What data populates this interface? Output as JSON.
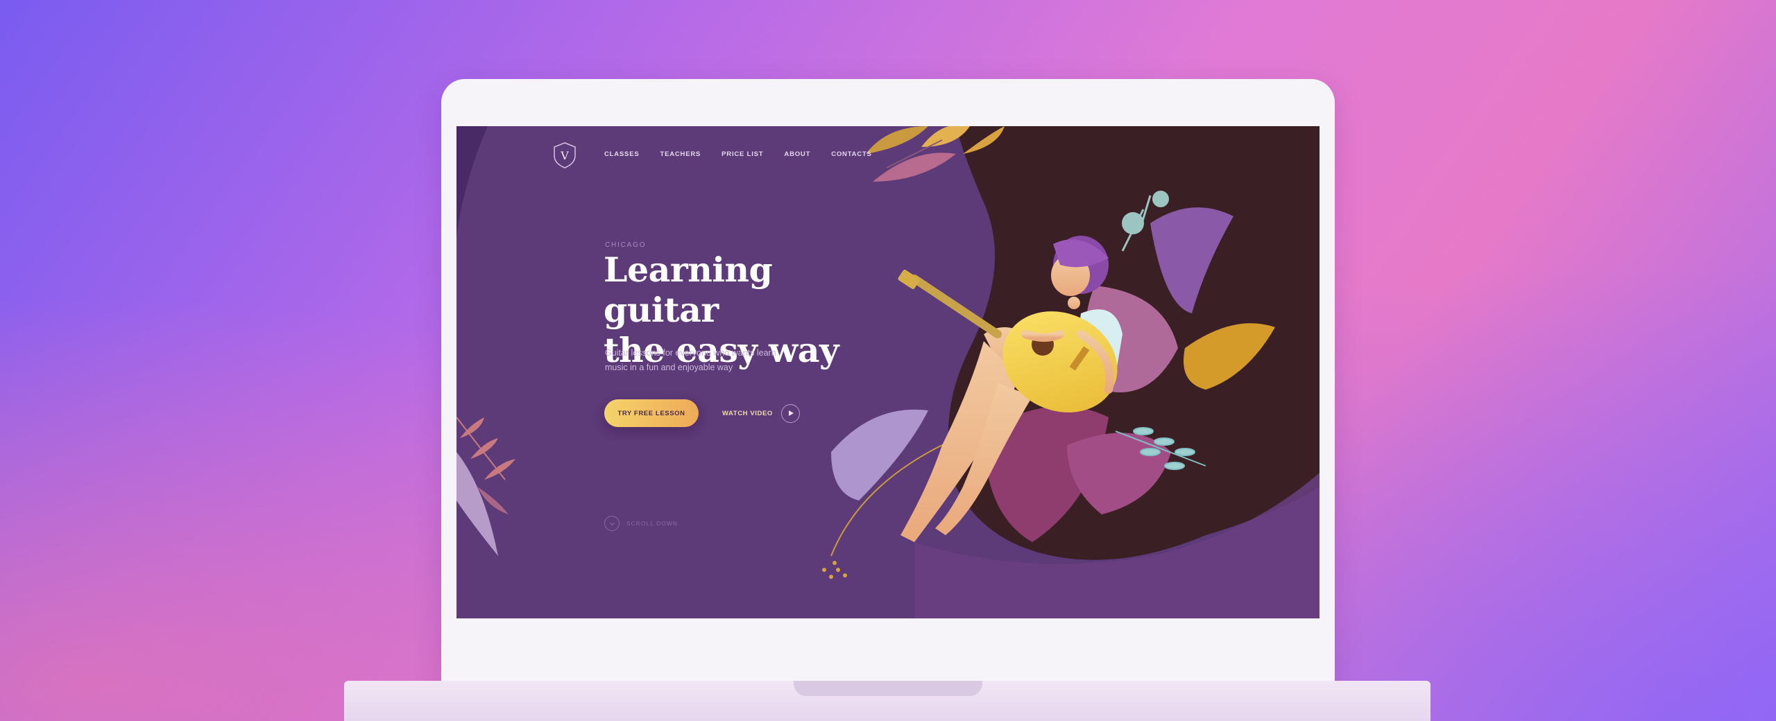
{
  "site": {
    "logo_letter": "V",
    "nav": [
      {
        "label": "CLASSES"
      },
      {
        "label": "TEACHERS"
      },
      {
        "label": "PRICE LIST"
      },
      {
        "label": "ABOUT"
      },
      {
        "label": "CONTACTS"
      }
    ]
  },
  "hero": {
    "eyebrow": "CHICAGO",
    "title_line1": "Learning guitar",
    "title_line2": "the easy way",
    "subtitle_line1": "Guitar lessons for everyone who wants learn",
    "subtitle_line2": "music in a fun and enjoyable way",
    "cta_label": "TRY FREE LESSON",
    "watch_label": "WATCH VIDEO",
    "scroll_label": "SCROLL DOWN"
  },
  "colors": {
    "screen_bg": "#5d3a78",
    "dark_blob": "#3a1f24",
    "accent_yellow": "#f5d36a",
    "accent_orange": "#eeaa58"
  },
  "icons": [
    "logo-shield-icon",
    "play-icon",
    "scroll-down-icon"
  ]
}
